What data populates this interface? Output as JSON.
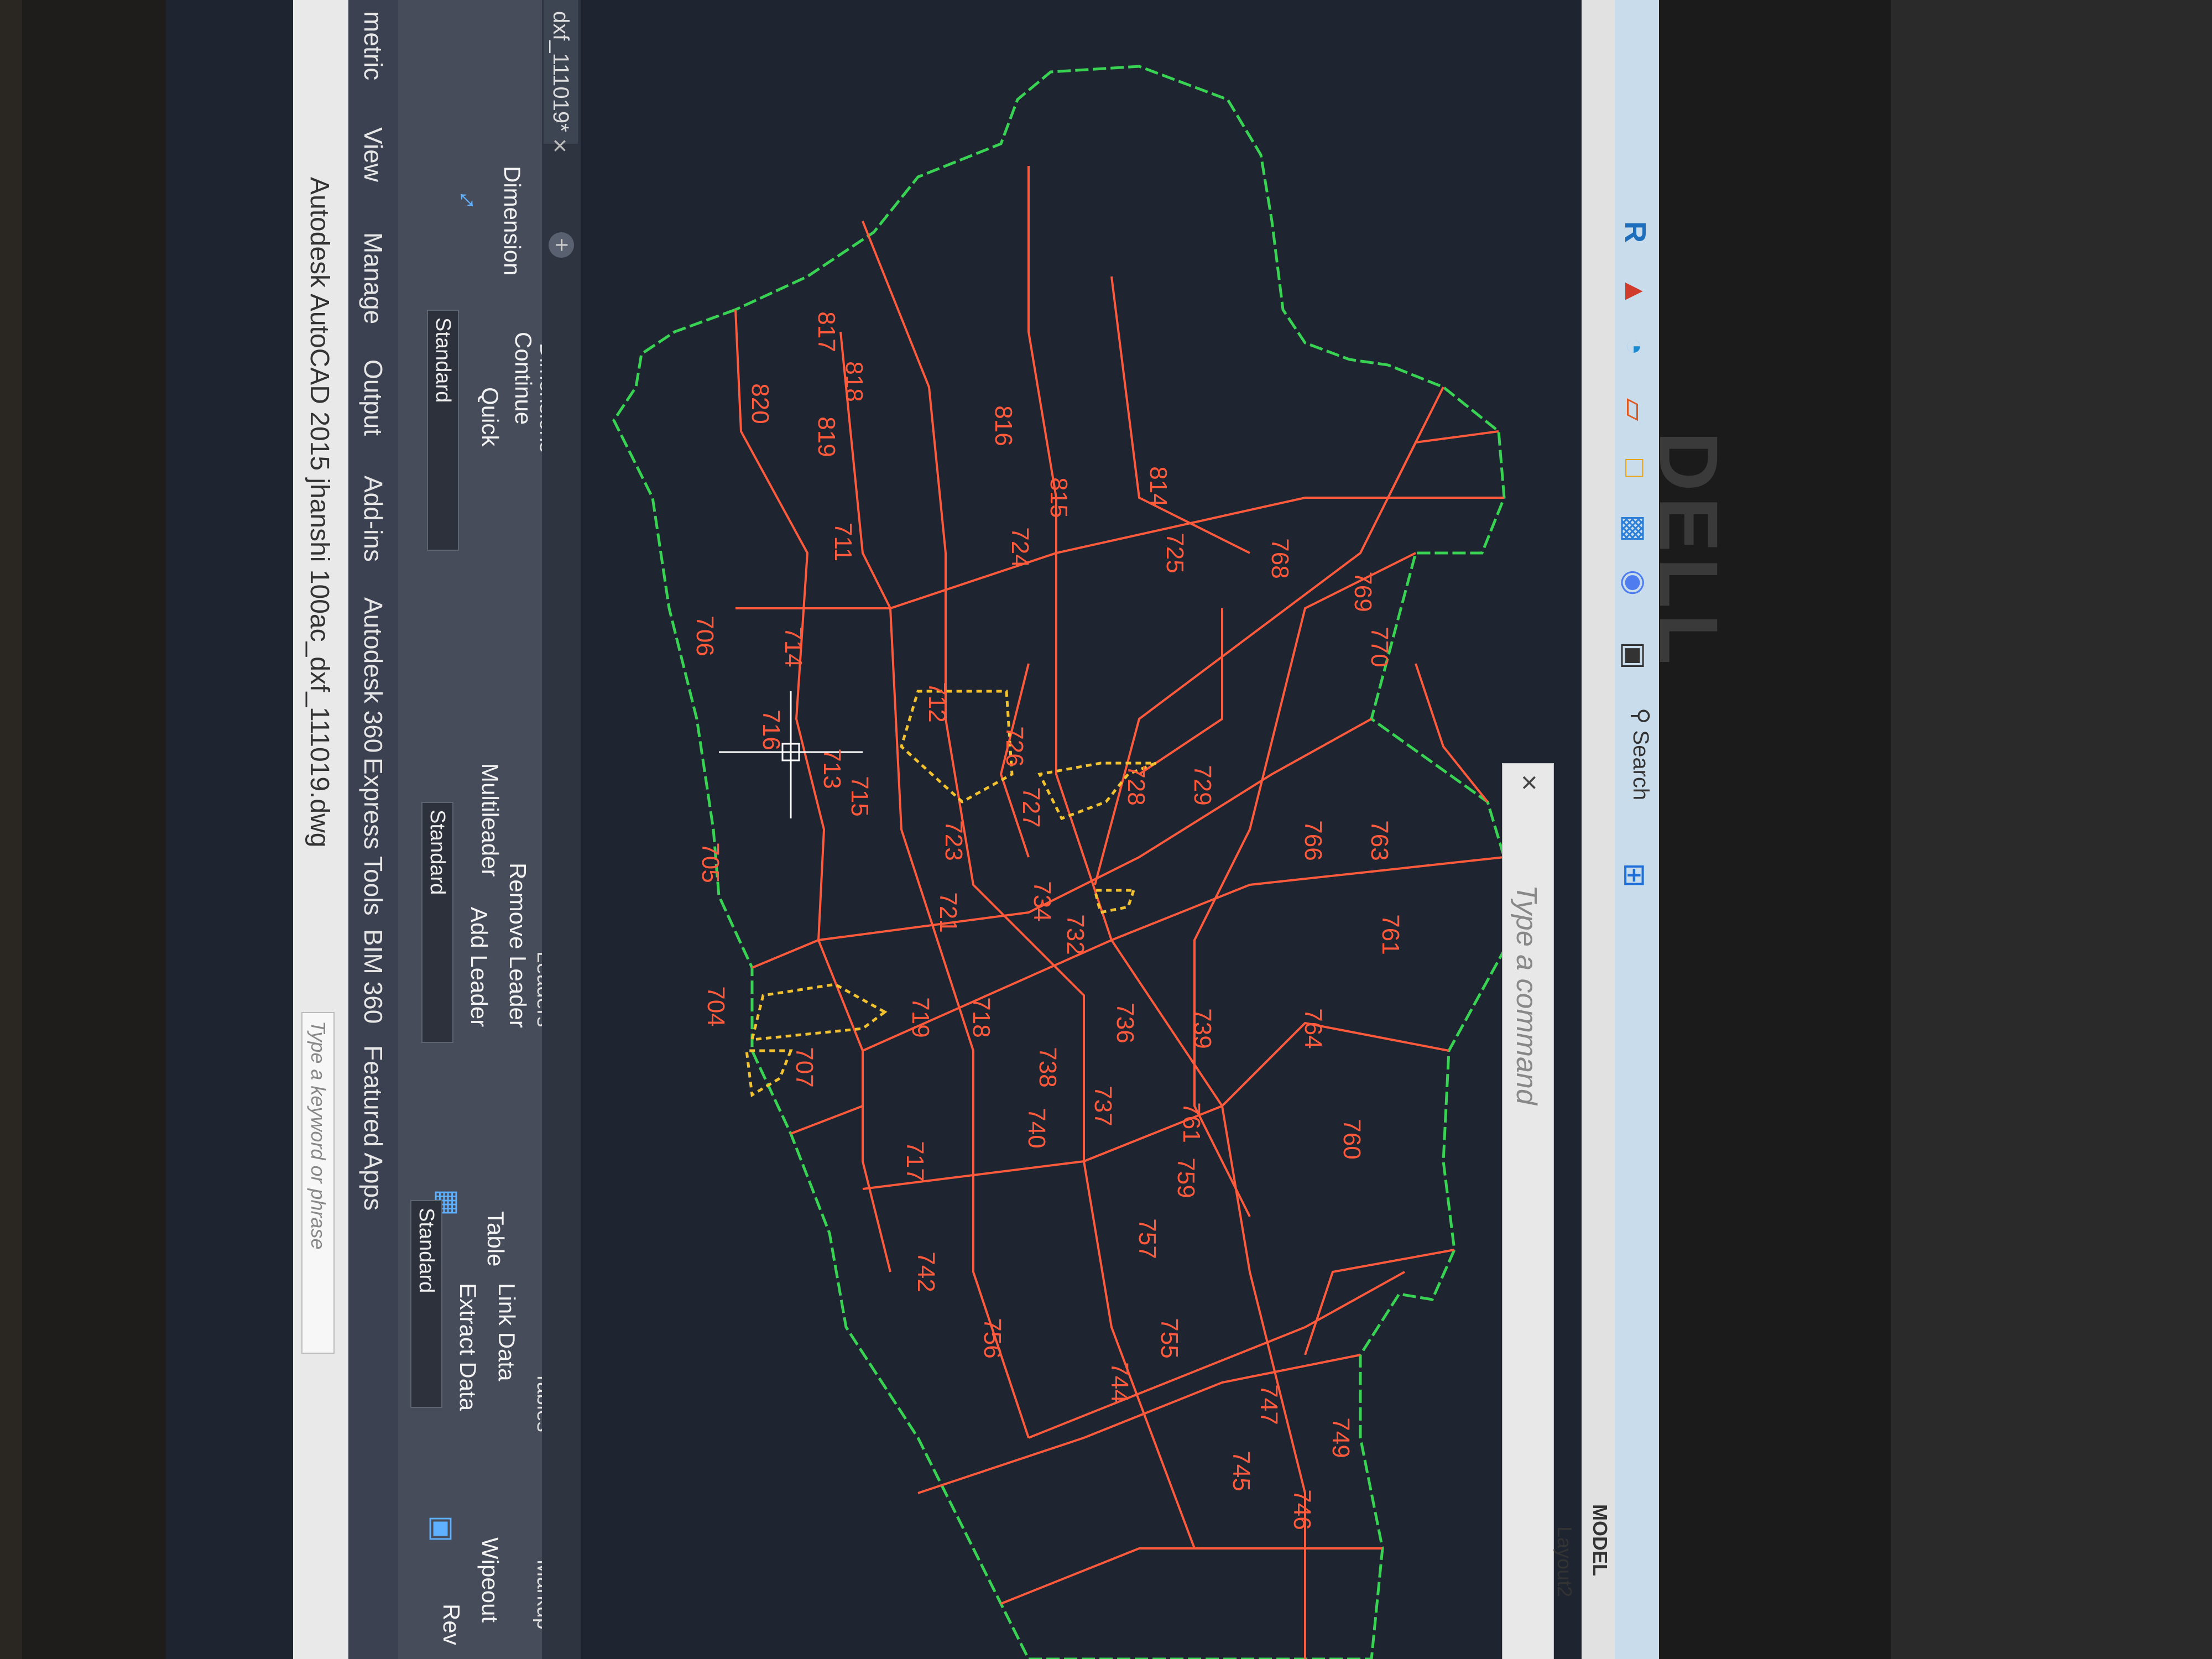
{
  "window": {
    "title": "Autodesk AutoCAD 2015   jhanshi 100ac_dxf_111019.dwg",
    "search_placeholder": "Type a keyword or phrase"
  },
  "menu": [
    "metric",
    "View",
    "Manage",
    "Output",
    "Add-ins",
    "Autodesk 360",
    "Express Tools",
    "BIM 360",
    "Featured Apps"
  ],
  "ribbon": {
    "dimension": {
      "big_button": "Dimension",
      "style": "Standard",
      "quick": "Quick",
      "continue": "Continue",
      "panel": "Dimensions"
    },
    "leaders": {
      "multileader": "Multileader",
      "style": "Standard",
      "add": "Add Leader",
      "remove": "Remove Leader",
      "panel": "Leaders"
    },
    "tables": {
      "table": "Table",
      "style": "Standard",
      "extract": "Extract Data",
      "link": "Link Data",
      "panel": "Tables"
    },
    "markup": {
      "wipeout": "Wipeout",
      "revcloud": "Rev",
      "panel": "Markup"
    }
  },
  "file_tab": "dxf_111019*",
  "parcels": [
    "817",
    "818",
    "816",
    "815",
    "814",
    "820",
    "819",
    "711",
    "724",
    "725",
    "768",
    "769",
    "770",
    "706",
    "714",
    "712",
    "726",
    "727",
    "728",
    "729",
    "766",
    "716",
    "713",
    "715",
    "723",
    "763",
    "705",
    "734",
    "732",
    "721",
    "761",
    "704",
    "707",
    "719",
    "718",
    "736",
    "739",
    "764",
    "738",
    "740",
    "737",
    "761",
    "760",
    "717",
    "759",
    "757",
    "742",
    "756",
    "755",
    "744",
    "747",
    "745",
    "746",
    "749"
  ],
  "command_placeholder": "Type a command",
  "status": {
    "model": "MODEL",
    "layout": "Layout2"
  },
  "taskbar": {
    "search": "Search"
  },
  "brand": "DELL",
  "colors": {
    "canvas": "#1e2430",
    "parcel_line": "#ff5a3c",
    "boundary": "#39d353",
    "highlight": "#f2c12e"
  }
}
